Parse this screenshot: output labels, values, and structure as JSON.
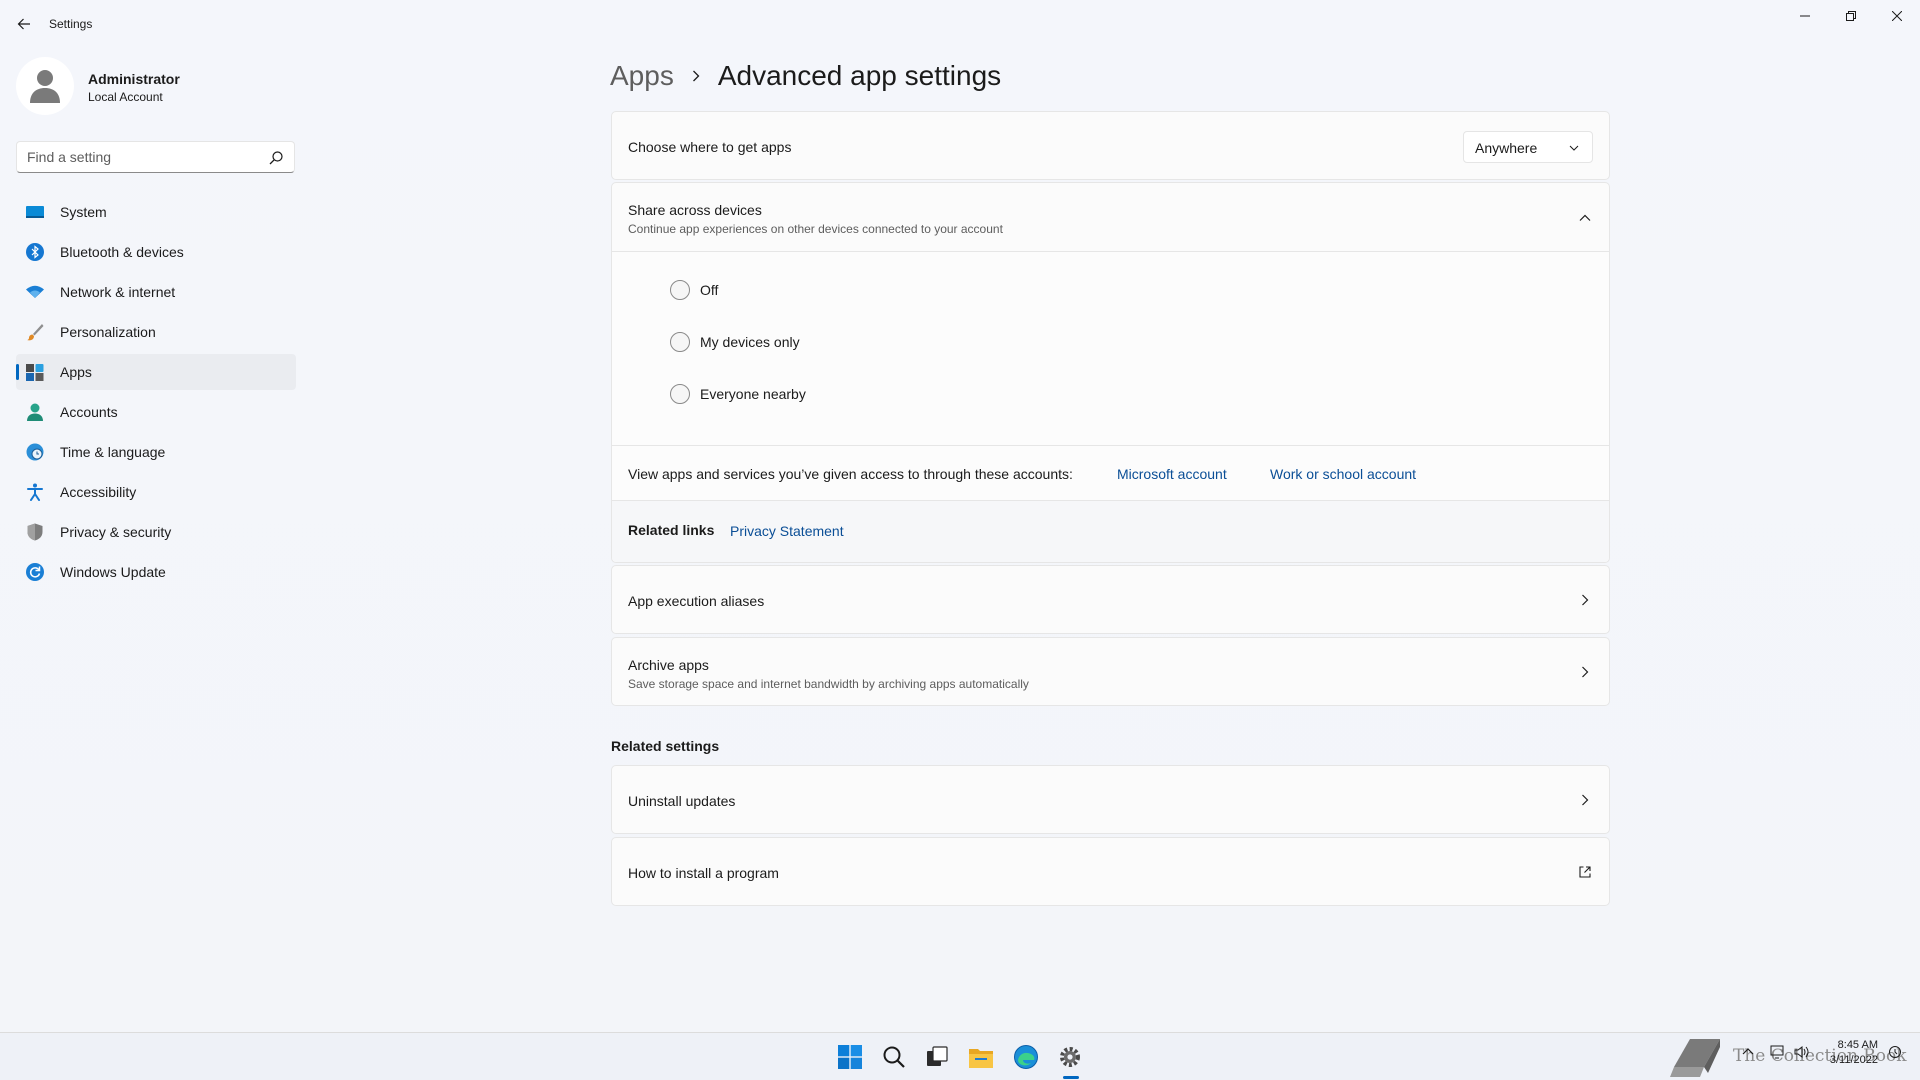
{
  "app": {
    "title": "Settings"
  },
  "profile": {
    "name": "Administrator",
    "account_type": "Local Account"
  },
  "search": {
    "placeholder": "Find a setting"
  },
  "sidebar": {
    "items": [
      {
        "label": "System",
        "icon": "system-icon"
      },
      {
        "label": "Bluetooth & devices",
        "icon": "bluetooth-icon"
      },
      {
        "label": "Network & internet",
        "icon": "wifi-icon"
      },
      {
        "label": "Personalization",
        "icon": "brush-icon"
      },
      {
        "label": "Apps",
        "icon": "apps-icon",
        "selected": true
      },
      {
        "label": "Accounts",
        "icon": "person-icon"
      },
      {
        "label": "Time & language",
        "icon": "globe-clock-icon"
      },
      {
        "label": "Accessibility",
        "icon": "accessibility-icon"
      },
      {
        "label": "Privacy & security",
        "icon": "shield-icon"
      },
      {
        "label": "Windows Update",
        "icon": "update-icon"
      }
    ]
  },
  "header": {
    "parent": "Apps",
    "current": "Advanced app settings"
  },
  "get_apps": {
    "title": "Choose where to get apps",
    "value": "Anywhere"
  },
  "share": {
    "title": "Share across devices",
    "desc": "Continue app experiences on other devices connected to your account",
    "options": [
      "Off",
      "My devices only",
      "Everyone nearby"
    ],
    "accounts_text": "View apps and services you’ve given access to through these accounts:",
    "microsoft_account": "Microsoft account",
    "work_account": "Work or school account",
    "related_links_label": "Related links",
    "privacy_link": "Privacy Statement"
  },
  "aliases": {
    "title": "App execution aliases"
  },
  "archive": {
    "title": "Archive apps",
    "desc": "Save storage space and internet bandwidth by archiving apps automatically"
  },
  "related_settings": {
    "heading": "Related settings",
    "uninstall": "Uninstall updates",
    "install": "How to install a program"
  },
  "taskbar": {
    "time": "8:45 AM",
    "date": "3/11/2022",
    "watermark": "The Collection Book"
  },
  "colors": {
    "accent": "#0067c0",
    "link": "#0a4e96"
  }
}
